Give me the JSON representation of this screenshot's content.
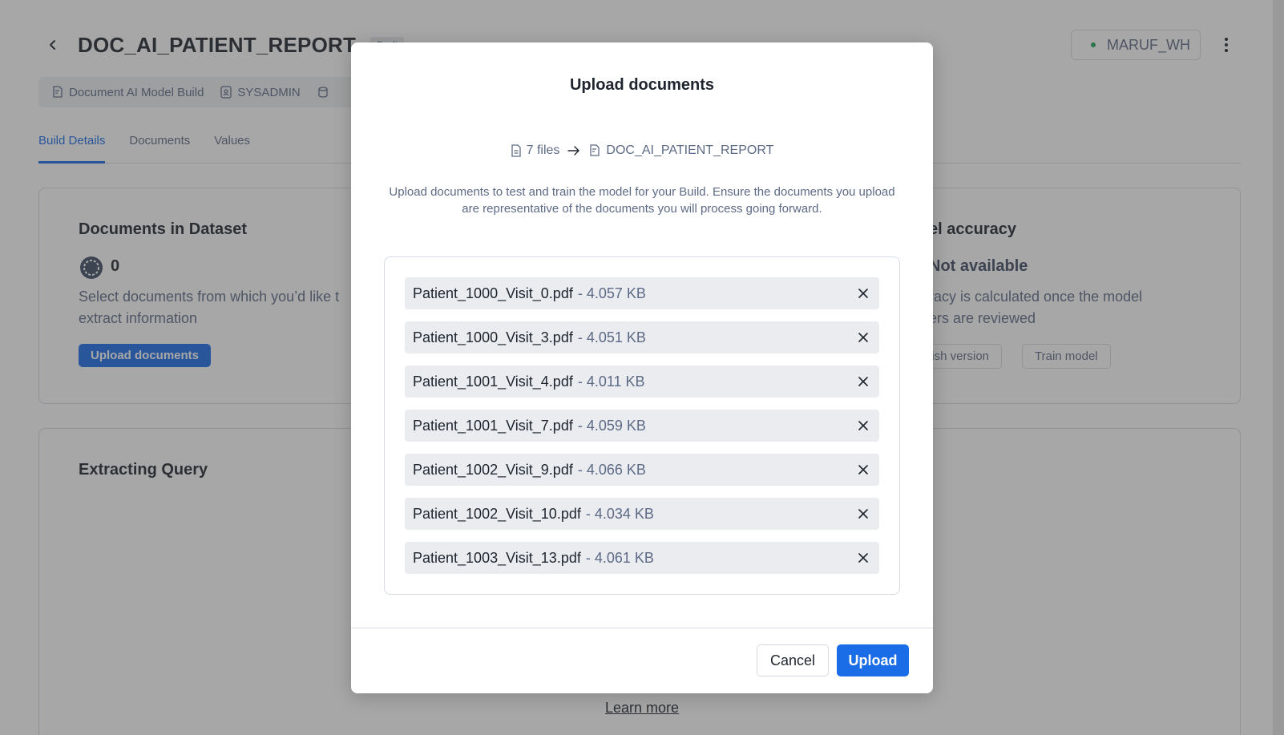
{
  "page": {
    "title": "DOC_AI_PATIENT_REPORT",
    "draft_badge": "Draft",
    "warehouse": "MARUF_WH",
    "meta": {
      "build_type": "Document AI Model Build",
      "role": "SYSADMIN"
    },
    "tabs": [
      {
        "label": "Build Details",
        "active": true
      },
      {
        "label": "Documents",
        "active": false
      },
      {
        "label": "Values",
        "active": false
      }
    ],
    "docs_card": {
      "title": "Documents in Dataset",
      "count": "0",
      "text_line1": "Select documents from which you’d like t",
      "text_line2": "extract information",
      "button": "Upload documents"
    },
    "accuracy_card": {
      "title": "el accuracy",
      "status": "Not available",
      "text_line1": "racy is calculated once the model",
      "text_line2": "ers are reviewed",
      "publish_button": "lish version",
      "train_button": "Train model"
    },
    "query_card": {
      "title": "Extracting Query",
      "learn_more": "Learn more"
    }
  },
  "modal": {
    "title": "Upload documents",
    "file_count": "7 files",
    "destination": "DOC_AI_PATIENT_REPORT",
    "description": "Upload documents to test and train the model for your Build. Ensure the documents you upload are representative of the documents you will process going forward.",
    "files": [
      {
        "name": "Patient_1000_Visit_0.pdf",
        "size": "- 4.057 KB"
      },
      {
        "name": "Patient_1000_Visit_3.pdf",
        "size": "- 4.051 KB"
      },
      {
        "name": "Patient_1001_Visit_4.pdf",
        "size": "- 4.011 KB"
      },
      {
        "name": "Patient_1001_Visit_7.pdf",
        "size": "- 4.059 KB"
      },
      {
        "name": "Patient_1002_Visit_9.pdf",
        "size": "- 4.066 KB"
      },
      {
        "name": "Patient_1002_Visit_10.pdf",
        "size": "- 4.034 KB"
      },
      {
        "name": "Patient_1003_Visit_13.pdf",
        "size": "- 4.061 KB"
      }
    ],
    "cancel_label": "Cancel",
    "upload_label": "Upload"
  },
  "colors": {
    "accent": "#1a6ce7",
    "text_primary": "#1e252f",
    "text_secondary": "#5d6a85",
    "status_green": "#1aa35c"
  }
}
